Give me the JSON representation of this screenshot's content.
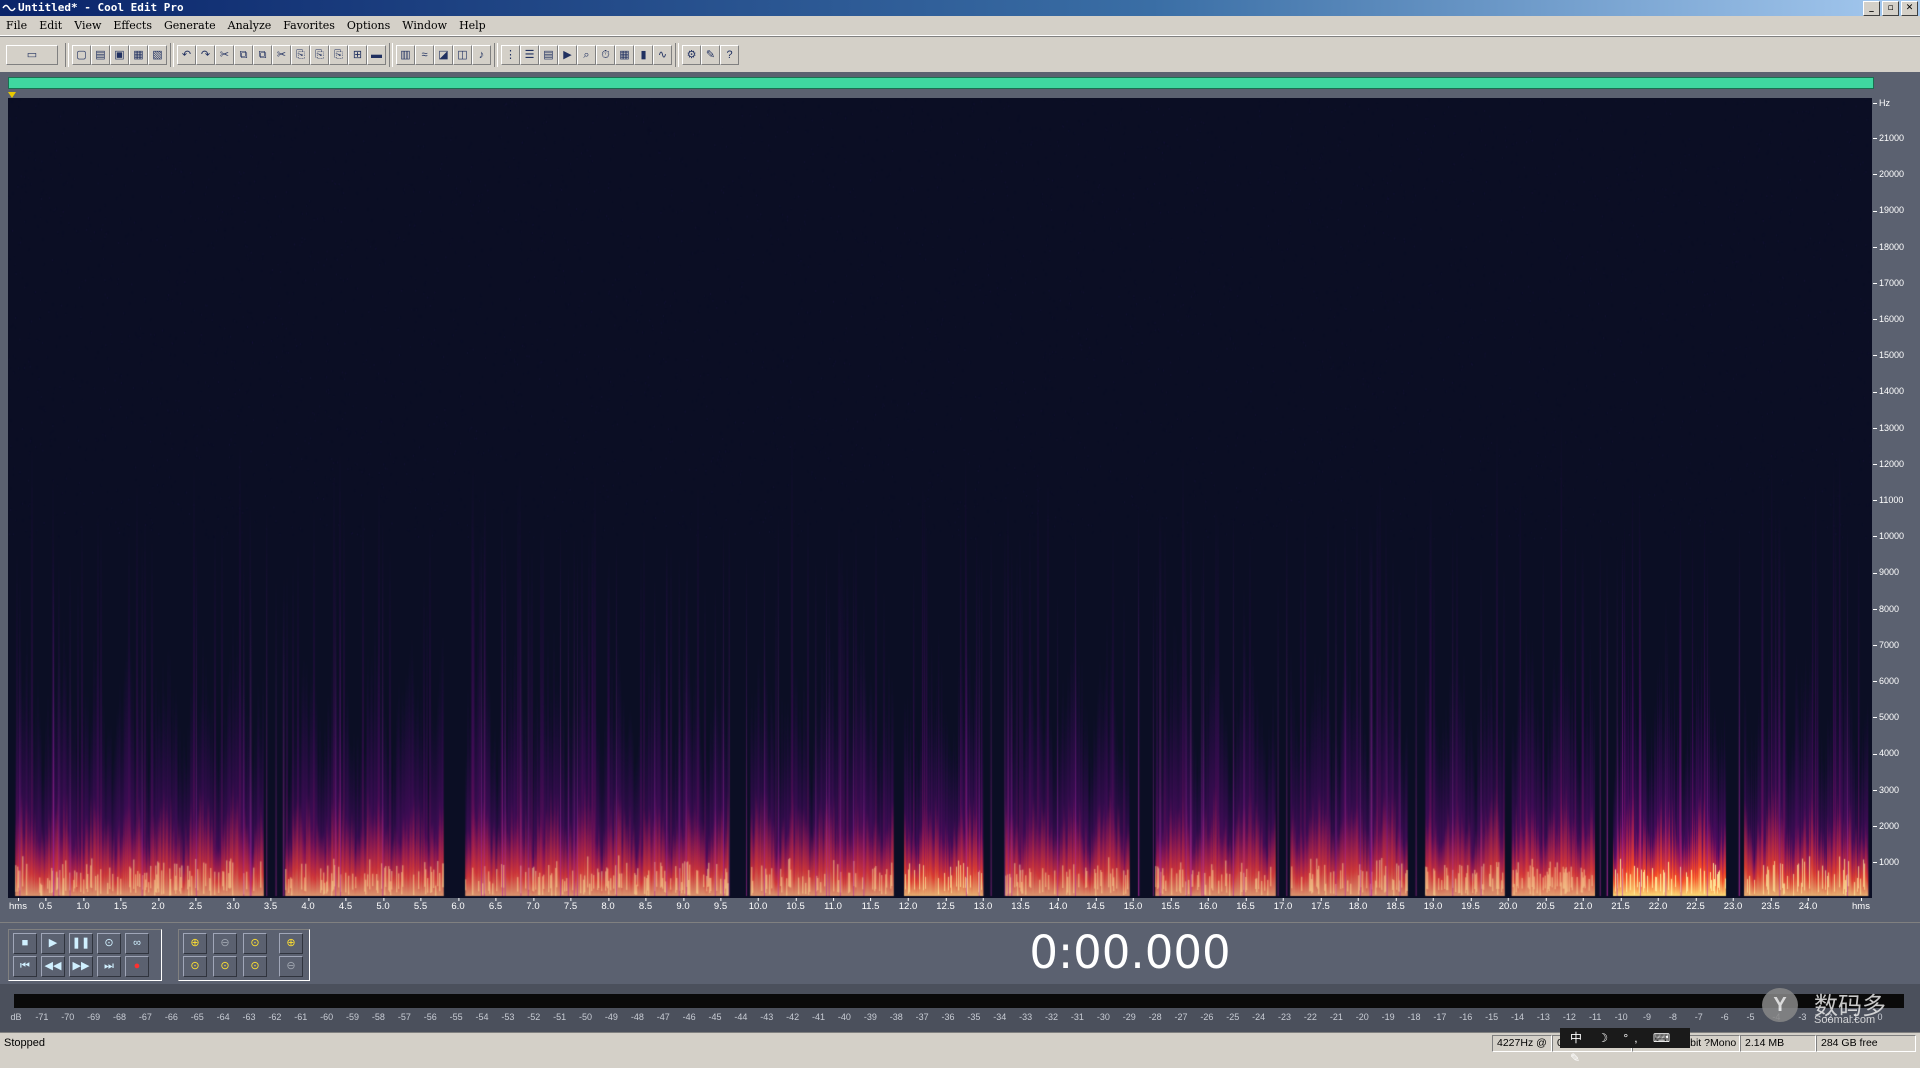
{
  "window": {
    "title": "Untitled* - Cool Edit Pro",
    "controls": [
      "_",
      "▫",
      "✕"
    ]
  },
  "menu": [
    "File",
    "Edit",
    "View",
    "Effects",
    "Generate",
    "Analyze",
    "Favorites",
    "Options",
    "Window",
    "Help"
  ],
  "toolbar": {
    "icons": [
      "multitrack-view-icon",
      "new-icon",
      "open-icon",
      "save-icon",
      "save-selection-icon",
      "close-icon",
      "undo-icon",
      "redo-icon",
      "repeat-icon",
      "copy-icon",
      "copy-to-new-icon",
      "cut-icon",
      "paste-icon",
      "paste-to-new-icon",
      "mix-paste-icon",
      "trim-icon",
      "silence-icon",
      "spectral-view-icon",
      "waveform-view-icon",
      "spectral-pan-icon",
      "spectral-phase-icon",
      "pitch-icon",
      "show-cues-icon",
      "cue-list-icon",
      "play-list-icon",
      "play-icon",
      "zoom-view-icon",
      "time-format-icon",
      "grid-icon",
      "meter-icon",
      "frequency-analysis-icon",
      "settings-icon",
      "scripts-icon",
      "help-icon"
    ]
  },
  "spectrogram": {
    "y_unit": "Hz",
    "y_ticks": [
      "21000",
      "20000",
      "19000",
      "18000",
      "17000",
      "16000",
      "15000",
      "14000",
      "13000",
      "12000",
      "11000",
      "10000",
      "9000",
      "8000",
      "7000",
      "6000",
      "5000",
      "4000",
      "3000",
      "2000",
      "1000"
    ],
    "x_unit_left": "hms",
    "x_unit_right": "hms",
    "x_ticks": [
      "0.5",
      "1.0",
      "1.5",
      "2.0",
      "2.5",
      "3.0",
      "3.5",
      "4.0",
      "4.5",
      "5.0",
      "5.5",
      "6.0",
      "6.5",
      "7.0",
      "7.5",
      "8.0",
      "8.5",
      "9.0",
      "9.5",
      "10.0",
      "10.5",
      "11.0",
      "11.5",
      "12.0",
      "12.5",
      "13.0",
      "13.5",
      "14.0",
      "14.5",
      "15.0",
      "15.5",
      "16.0",
      "16.5",
      "17.0",
      "17.5",
      "18.0",
      "18.5",
      "19.0",
      "19.5",
      "20.0",
      "20.5",
      "21.0",
      "21.5",
      "22.0",
      "22.5",
      "23.0",
      "23.5",
      "24.0"
    ],
    "colors": {
      "background": "#0b0e24",
      "low": "#3a0a6a",
      "mid": "#c01070",
      "high": "#ff4020",
      "peak": "#ffe080"
    }
  },
  "transport": {
    "buttons_row1": [
      "stop-icon",
      "play-icon",
      "pause-icon",
      "play-to-end-icon",
      "loop-icon"
    ],
    "buttons_row2": [
      "go-to-start-icon",
      "rewind-icon",
      "fast-forward-icon",
      "go-to-end-icon",
      "record-icon"
    ],
    "glyphs_row1": [
      "■",
      "▶",
      "❚❚",
      "⊙",
      "∞"
    ],
    "glyphs_row2": [
      "⏮",
      "◀◀",
      "▶▶",
      "⏭",
      "●"
    ]
  },
  "zoom": {
    "buttons_row1": [
      "zoom-in-horizontal-icon",
      "zoom-out-horizontal-icon",
      "zoom-full-icon",
      "zoom-in-vertical-icon"
    ],
    "buttons_row2": [
      "zoom-left-icon",
      "zoom-right-icon",
      "zoom-selection-icon",
      "zoom-out-vertical-icon"
    ],
    "glyphs": [
      "⊕",
      "⊖",
      "⊙",
      "⊕",
      "⊙",
      "⊙",
      "⊙",
      "⊖"
    ]
  },
  "time_display": "0:00.000",
  "level_meter": {
    "ticks": [
      "dB",
      "-71",
      "-70",
      "-69",
      "-68",
      "-67",
      "-66",
      "-65",
      "-64",
      "-63",
      "-62",
      "-61",
      "-60",
      "-59",
      "-58",
      "-57",
      "-56",
      "-55",
      "-54",
      "-53",
      "-52",
      "-51",
      "-50",
      "-49",
      "-48",
      "-47",
      "-46",
      "-45",
      "-44",
      "-43",
      "-42",
      "-41",
      "-40",
      "-39",
      "-38",
      "-37",
      "-36",
      "-35",
      "-34",
      "-33",
      "-32",
      "-31",
      "-30",
      "-29",
      "-28",
      "-27",
      "-26",
      "-25",
      "-24",
      "-23",
      "-22",
      "-21",
      "-20",
      "-19",
      "-18",
      "-17",
      "-16",
      "-15",
      "-14",
      "-13",
      "-12",
      "-11",
      "-10",
      "-9",
      "-8",
      "-7",
      "-6",
      "-5",
      "-4",
      "-3",
      "-2",
      "-1",
      "0"
    ]
  },
  "status": {
    "state": "Stopped",
    "cells": [
      "4227Hz @",
      "0:00.000",
      "44100 ?16-bit ?Mono",
      "2.14 MB",
      "284 GB free"
    ]
  },
  "ime": "中 ☽ °, ⌨ ✎",
  "watermark": {
    "cn": "数码多",
    "en": "Soomal.com",
    "logo": "Y"
  }
}
